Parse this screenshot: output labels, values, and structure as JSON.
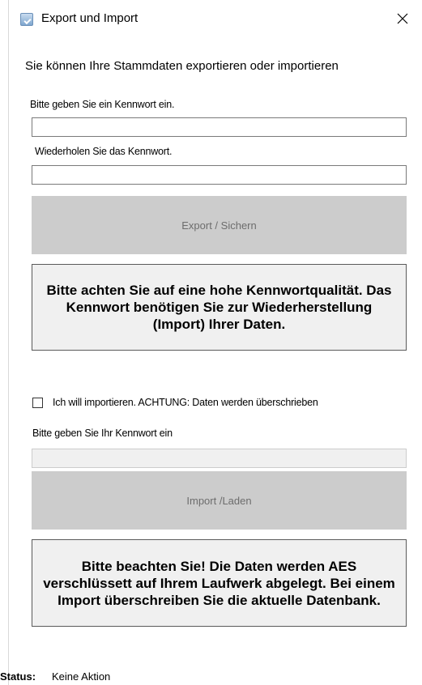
{
  "window": {
    "title": "Export und Import",
    "icon": "app-icon",
    "close_icon": "close-icon"
  },
  "export": {
    "intro": "Sie können Ihre Stammdaten exportieren oder importieren",
    "password_label": "Bitte geben Sie ein Kennwort ein.",
    "password_value": "",
    "repeat_label": "Wiederholen Sie das Kennwort.",
    "repeat_value": "",
    "button_label": "Export / Sichern",
    "notice": "Bitte achten Sie auf eine hohe Kennwortqualität. Das Kennwort benötigen Sie zur Wiederherstellung (Import) Ihrer Daten."
  },
  "import": {
    "checkbox_label": "Ich will importieren. ACHTUNG: Daten werden überschrieben",
    "checkbox_checked": false,
    "password_label": "Bitte geben Sie Ihr Kennwort ein",
    "password_value": "",
    "button_label": "Import /Laden",
    "notice": "Bitte beachten Sie! Die Daten werden AES verschlüssett auf Ihrem Laufwerk abgelegt. Bei einem Import überschreiben Sie die aktuelle Datenbank."
  },
  "status": {
    "label": "Status:",
    "value": "Keine Aktion"
  }
}
